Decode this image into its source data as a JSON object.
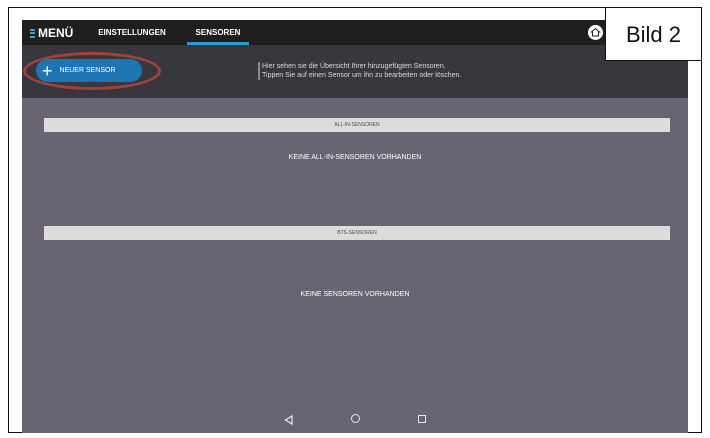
{
  "topbar": {
    "menu_label": "MENÜ",
    "tabs": [
      {
        "label": "EINSTELLUNGEN",
        "active": false
      },
      {
        "label": "SENSOREN",
        "active": true
      }
    ]
  },
  "header": {
    "new_sensor_label": "NEUER SENSOR",
    "info_line1": "Hier sehen sie die Übersicht Ihrer hinzugefügten Sensoren.",
    "info_line2": "Tippen Sie auf einen Sensor um ihn zu bearbeiten oder löschen."
  },
  "sections": [
    {
      "title": "ALL-IN-SENSOREN",
      "empty_message": "KEINE ALL-IN-SENSOREN VORHANDEN"
    },
    {
      "title": "BTS-SENSOREN",
      "empty_message": "KEINE SENSOREN VORHANDEN"
    }
  ],
  "annotation": {
    "label": "Bild 2"
  },
  "colors": {
    "accent": "#2a9bd8",
    "button": "#1f75b3",
    "highlight": "#a0413f",
    "background": "#696471"
  },
  "icons": {
    "menu": "hamburger-icon",
    "home": "home-icon",
    "back": "back-triangle-icon",
    "nav_home": "circle-home-icon",
    "recents": "square-recents-icon"
  }
}
